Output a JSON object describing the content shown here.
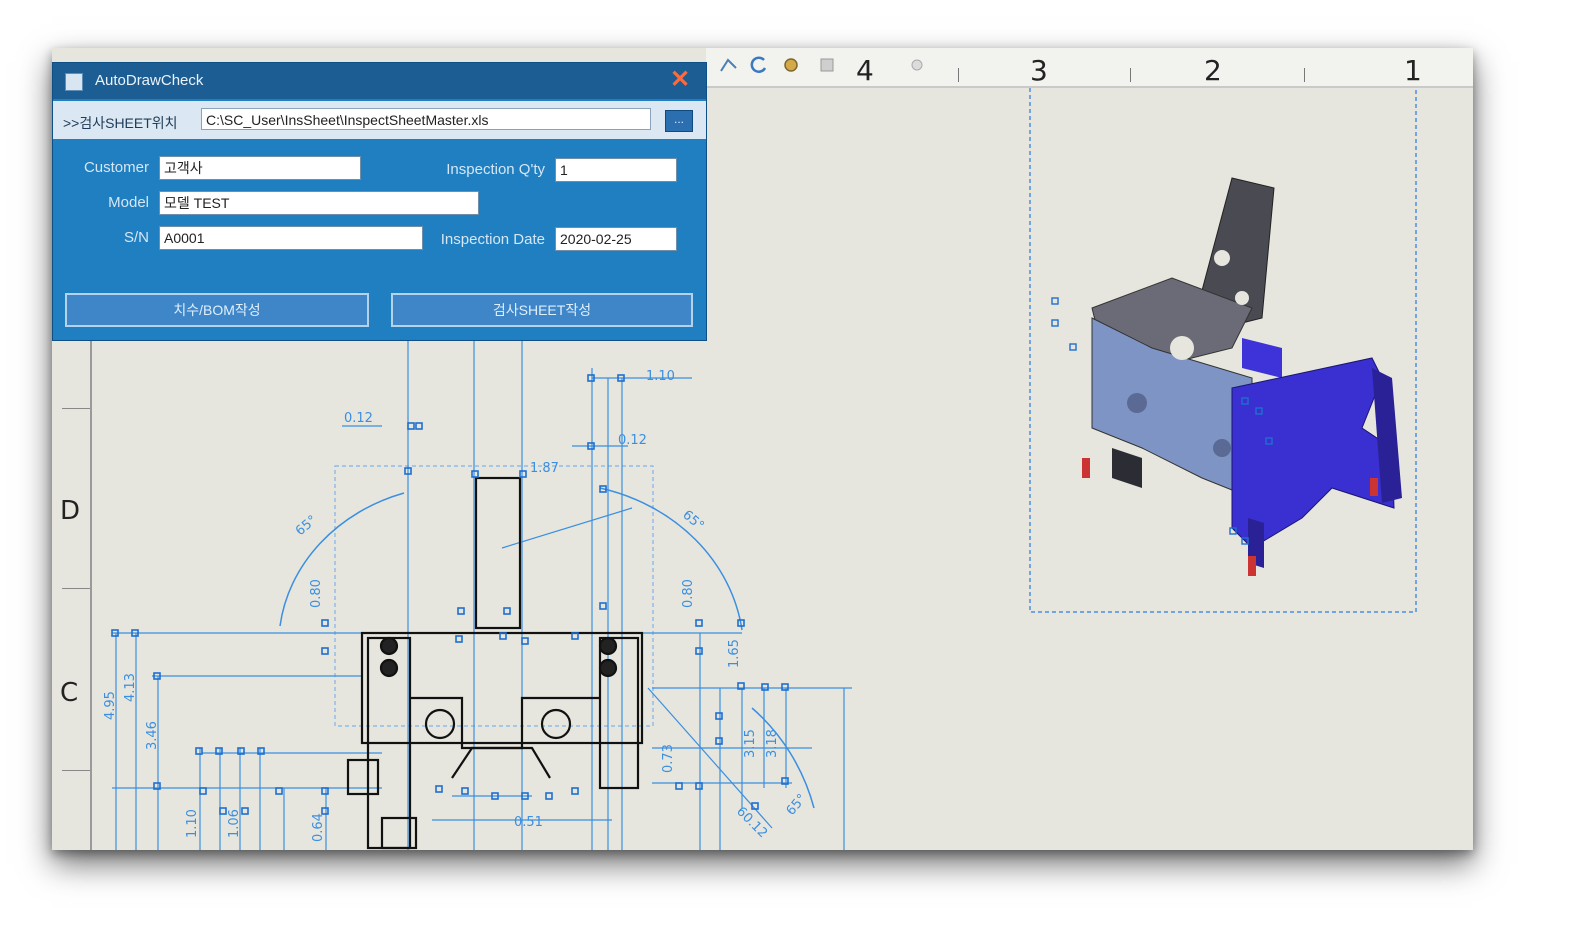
{
  "dialog": {
    "title": "AutoDrawCheck",
    "close_icon": "close-icon",
    "path_label": ">>검사SHEET위치",
    "path_value": "C:\\SC_User\\InsSheet\\InspectSheetMaster.xls",
    "browse_label": "...",
    "fields": {
      "customer_label": "Customer",
      "customer_value": "고객사",
      "model_label": "Model",
      "model_value": "모델 TEST",
      "sn_label": "S/N",
      "sn_value": "A0001",
      "qty_label": "Inspection Q'ty",
      "qty_value": "1",
      "date_label": "Inspection Date",
      "date_value": "2020-02-25"
    },
    "buttons": {
      "bom": "치수/BOM작성",
      "sheet": "검사SHEET작성"
    }
  },
  "ruler": {
    "top_labels": [
      "4",
      "3",
      "2",
      "1"
    ],
    "side_labels": [
      "D",
      "C"
    ]
  },
  "dimensions": {
    "d1": "1.10",
    "d2": "0.12",
    "d3": "0.12",
    "d4": "1.87",
    "d5": "65°",
    "d6": "65°",
    "d7": "0.80",
    "d8": "0.80",
    "d9": "4.95",
    "d10": "4.13",
    "d11": "3.46",
    "d12": "1.65",
    "d13": "3.15",
    "d14": "3.18",
    "d15": "0.73",
    "d16": "60.12",
    "d17": "0.51",
    "d18": "1.10",
    "d19": "0.64",
    "d20": "1.06",
    "d21": "65°"
  },
  "colors": {
    "dialog_blue": "#1f7fc0",
    "dimension_blue": "#3b8fe0",
    "part_blue": "#3a2fd0",
    "part_gray": "#5a5a66"
  }
}
